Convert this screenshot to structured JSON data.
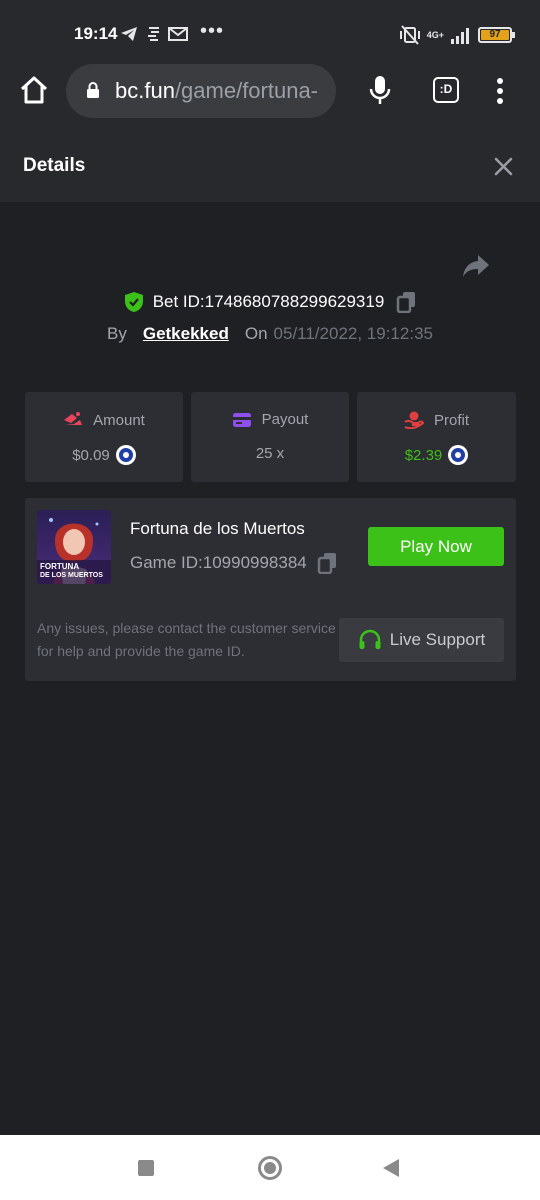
{
  "status_bar": {
    "time": "19:14",
    "icons": [
      "telegram-icon",
      "data-icon",
      "mail-icon"
    ],
    "more": "•••",
    "network": "4G+",
    "battery": "97"
  },
  "browser": {
    "url_host": "bc.fun",
    "url_path": "/game/fortuna-",
    "tab_label": ":D"
  },
  "details": {
    "title": "Details",
    "bet_label": "Bet ID: ",
    "bet_id": "1748680788299629319",
    "by_label": "By",
    "username": "Getkekked",
    "on_label": "On",
    "date": "05/11/2022, 19:12:35"
  },
  "stats": [
    {
      "label": "Amount",
      "value": "$0.09",
      "value_color": "#a3a6ad",
      "coin": true,
      "icon": "amount-icon",
      "icon_color": "#e8455d"
    },
    {
      "label": "Payout",
      "value": "25 x",
      "value_color": "#a3a6ad",
      "coin": false,
      "icon": "payout-icon",
      "icon_color": "#8e4ef0"
    },
    {
      "label": "Profit",
      "value": "$2.39",
      "value_color": "#3bc117",
      "coin": true,
      "icon": "profit-icon",
      "icon_color": "#e23f3f"
    }
  ],
  "game": {
    "name": "Fortuna de los Muertos",
    "id_label": "Game ID: ",
    "id": "10990998384",
    "thumb_text_1": "FORTUNA",
    "thumb_text_2": "DE LOS MUERTOS",
    "play_label": "Play Now",
    "support_text": "Any issues, please contact the customer service for help and provide the game ID.",
    "support_label": "Live Support"
  },
  "colors": {
    "accent_green": "#3bc117",
    "background": "#1f2024",
    "card": "#2d2e33"
  }
}
